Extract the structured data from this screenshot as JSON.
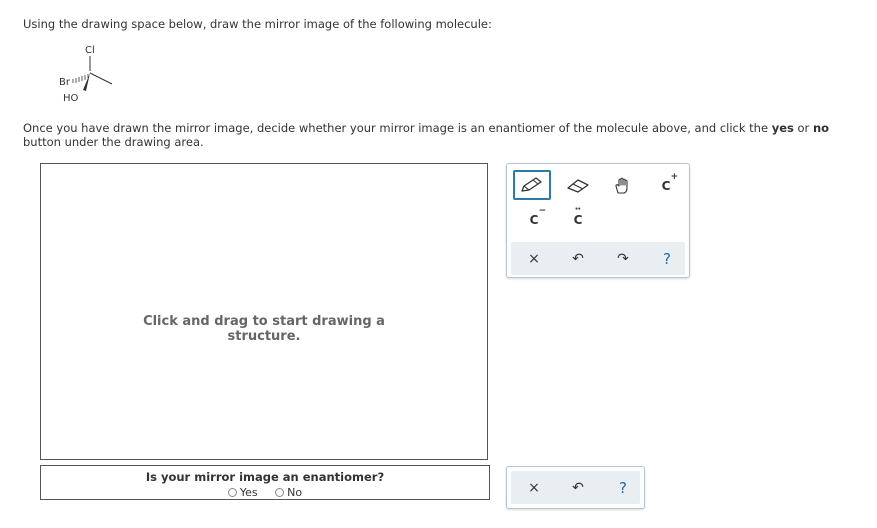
{
  "instruction_top": "Using the drawing space below, draw the mirror image of the following molecule:",
  "molecule": {
    "cl_label": "Cl",
    "br_label": "Br",
    "ho_label": "HO"
  },
  "instruction_bottom": {
    "part1": "Once you have drawn the mirror image, decide whether your mirror image is an enantiomer of the molecule above, and click the ",
    "yes_word": "yes",
    "part2": " or ",
    "no_word": "no",
    "part3": " button under the drawing area."
  },
  "canvas": {
    "hint_line1": "Click and drag to start drawing a",
    "hint_line2": "structure."
  },
  "question": {
    "text": "Is your mirror image an enantiomer?",
    "option_yes": "Yes",
    "option_no": "No"
  },
  "toolbar": {
    "carbanion_label": "C",
    "carbanion_charge": "−",
    "carbene_label": "C",
    "carbene_dots": "··",
    "carbocation_label": "C",
    "carbocation_charge": "+",
    "clear_glyph": "×",
    "undo_glyph": "↶",
    "redo_glyph": "↷",
    "help_glyph": "?",
    "icons": [
      "pencil-icon",
      "eraser-icon",
      "hand-icon",
      "carbocation-icon",
      "carbanion-icon",
      "carbene-icon",
      "clear-icon",
      "undo-icon",
      "redo-icon",
      "help-icon"
    ]
  },
  "colors": {
    "accent": "#2c7aa8",
    "toolbar_row_bg": "#e9eef2",
    "help": "#2c6aa0"
  }
}
